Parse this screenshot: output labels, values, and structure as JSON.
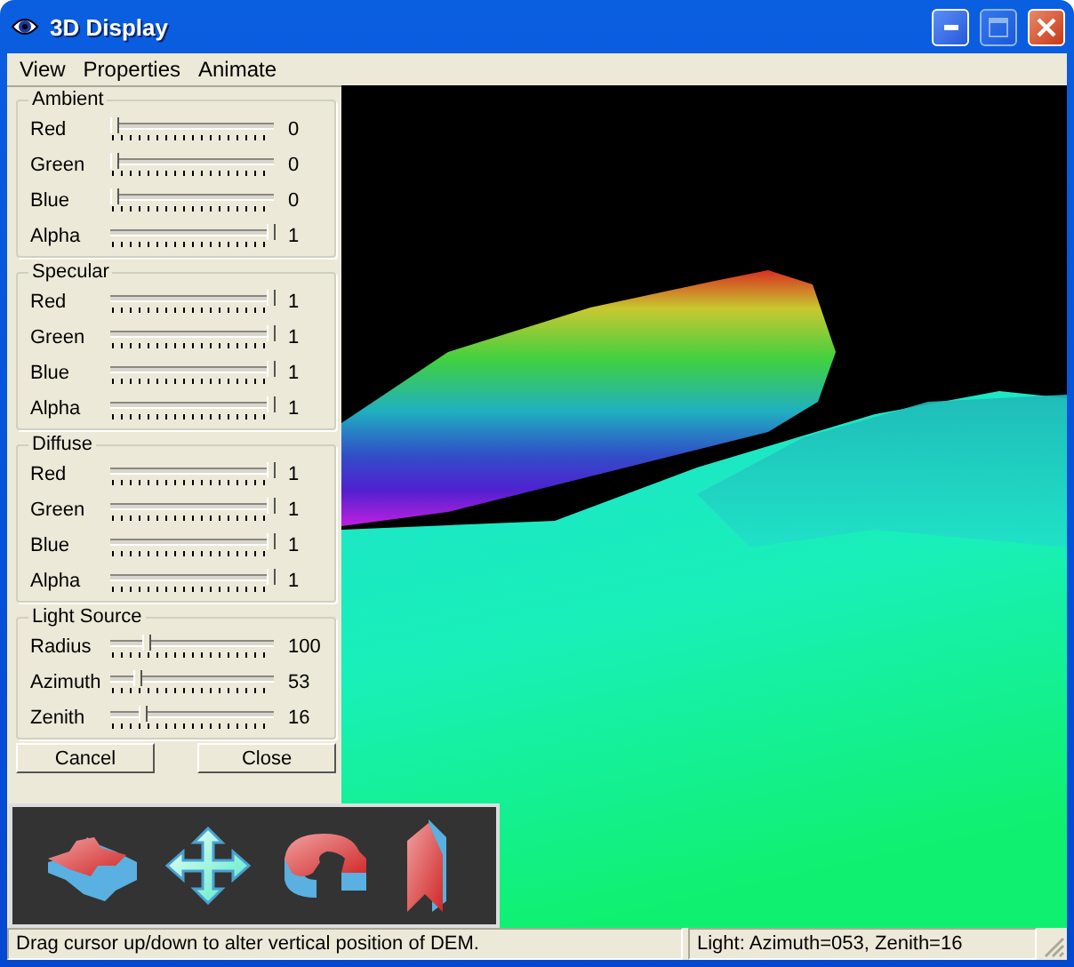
{
  "window": {
    "title": "3D Display",
    "maximize_disabled": true
  },
  "menu": [
    {
      "label": "View"
    },
    {
      "label": "Properties"
    },
    {
      "label": "Animate"
    }
  ],
  "groups": [
    {
      "title": "Ambient",
      "sliders": [
        {
          "label": "Red",
          "level": 0,
          "value": "0"
        },
        {
          "label": "Green",
          "level": 0,
          "value": "0"
        },
        {
          "label": "Blue",
          "level": 0,
          "value": "0"
        },
        {
          "label": "Alpha",
          "level": 1,
          "value": "1"
        }
      ]
    },
    {
      "title": "Specular",
      "sliders": [
        {
          "label": "Red",
          "level": 1,
          "value": "1"
        },
        {
          "label": "Green",
          "level": 1,
          "value": "1"
        },
        {
          "label": "Blue",
          "level": 1,
          "value": "1"
        },
        {
          "label": "Alpha",
          "level": 1,
          "value": "1"
        }
      ]
    },
    {
      "title": "Diffuse",
      "sliders": [
        {
          "label": "Red",
          "level": 1,
          "value": "1"
        },
        {
          "label": "Green",
          "level": 1,
          "value": "1"
        },
        {
          "label": "Blue",
          "level": 1,
          "value": "1"
        },
        {
          "label": "Alpha",
          "level": 1,
          "value": "1"
        }
      ]
    },
    {
      "title": "Light Source",
      "sliders": [
        {
          "label": "Radius",
          "level": 0.2,
          "value": "100"
        },
        {
          "label": "Azimuth",
          "level": 0.15,
          "value": "53"
        },
        {
          "label": "Zenith",
          "level": 0.18,
          "value": "16"
        }
      ]
    }
  ],
  "buttons": [
    {
      "label": "Cancel"
    },
    {
      "label": "Close"
    }
  ],
  "tools": [
    {
      "kind": "pan"
    },
    {
      "kind": "move"
    },
    {
      "kind": "rotate"
    },
    {
      "kind": "lift"
    }
  ],
  "status_bar": {
    "message": "Drag cursor up/down to alter vertical position of DEM.",
    "light": "Light: Azimuth=053, Zenith=16"
  }
}
